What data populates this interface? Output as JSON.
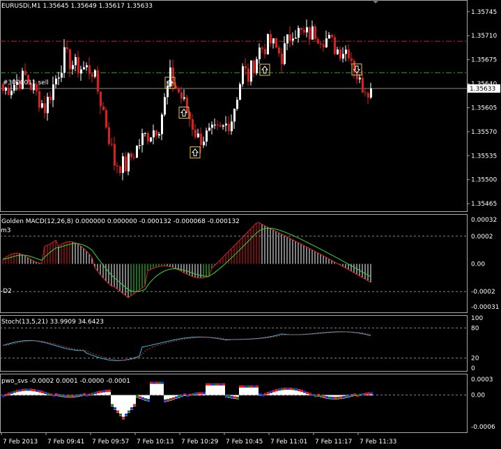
{
  "header": {
    "symbol_info": "EURUSDi,M1  1.35645 1.35649 1.35617 1.35633",
    "order_label": "#3000011 sell"
  },
  "colors": {
    "background": "#000000",
    "bull": "#ffffff",
    "bear": "#dc1e1e",
    "order_line": "#cc2222",
    "sl_line": "#22aa22",
    "macd_signal": "#33dd33",
    "stoch_main": "#33bbdd",
    "stoch_signal": "#dd3333",
    "pwo_white": "#ffffff",
    "pwo_red": "#ee1111",
    "pwo_blue": "#1133ee",
    "pwo_green": "#117711",
    "arrow": "#e8c84a",
    "grid_text": "#ffffff"
  },
  "price_axis": {
    "ticks": [
      "1.35745",
      "1.35710",
      "1.35675",
      "1.35640",
      "1.35605",
      "1.35570",
      "1.35535",
      "1.35500",
      "1.35465"
    ],
    "tick_values": [
      1.35745,
      1.3571,
      1.35675,
      1.3564,
      1.35605,
      1.3557,
      1.35535,
      1.355,
      1.35465
    ],
    "current_price": "1.35633",
    "current_value": 1.35633,
    "order_price": 1.35702,
    "sl_price": 1.35656
  },
  "macd": {
    "label": "Golden MACD(12,26,8) 0.000000 0.000000 -0.000132 -0.000068 -0.000132",
    "ticks": [
      "0.00032",
      "0.0002",
      "0.00",
      "-0.0002",
      "-0.00031"
    ],
    "tick_values": [
      0.00032,
      0.0002,
      0.0,
      -0.0002,
      -0.00031
    ],
    "level_hi_label": "m3",
    "level_lo_label": "-D2",
    "level_hi": 0.0002,
    "level_lo": -0.0002
  },
  "stoch": {
    "label": "Stoch(13,5,21) 33.9909 34.6423",
    "ticks": [
      "100",
      "80",
      "20",
      "0"
    ],
    "tick_values": [
      100,
      80,
      20,
      0
    ]
  },
  "pwo": {
    "label": "pwo_svs -0.0002 0.0001 -0.0000 -0.0001",
    "ticks": [
      "0.0003",
      "0.00",
      "-0.0006"
    ],
    "tick_values": [
      0.0003,
      0.0,
      -0.0006
    ]
  },
  "time_axis": {
    "labels": [
      "7 Feb 2013",
      "7 Feb 09:41",
      "7 Feb 09:57",
      "7 Feb 10:13",
      "7 Feb 10:29",
      "7 Feb 10:45",
      "7 Feb 11:01",
      "7 Feb 11:17",
      "7 Feb 11:33"
    ]
  },
  "chart_data": {
    "type": "candlestick",
    "symbol": "EURUSDi",
    "timeframe": "M1",
    "ohlc_last": {
      "open": 1.35645,
      "high": 1.35649,
      "low": 1.35617,
      "close": 1.35633
    },
    "close_path_keypoints": {
      "bar_index": [
        0,
        8,
        15,
        22,
        26,
        32,
        36,
        40,
        44,
        50,
        56,
        60,
        64,
        70,
        74,
        78,
        82,
        86,
        88,
        92,
        96,
        100,
        104,
        108,
        112,
        116,
        120,
        124,
        128,
        132
      ],
      "close": [
        1.3563,
        1.3565,
        1.35605,
        1.3568,
        1.35665,
        1.3566,
        1.356,
        1.35525,
        1.3552,
        1.3556,
        1.3558,
        1.3565,
        1.3562,
        1.3556,
        1.35565,
        1.3557,
        1.3559,
        1.3566,
        1.3565,
        1.3569,
        1.357,
        1.3568,
        1.3572,
        1.3571,
        1.35715,
        1.35705,
        1.3569,
        1.3569,
        1.3564,
        1.35633
      ]
    },
    "signal_arrows_bar_index": [
      60,
      65,
      69,
      94,
      127
    ]
  }
}
